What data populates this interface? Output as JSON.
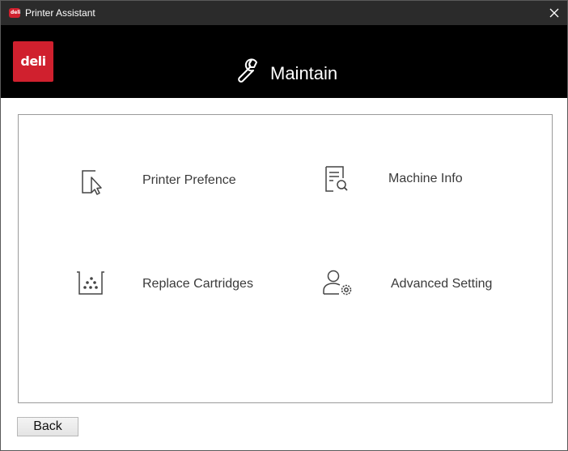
{
  "window": {
    "title": "Printer Assistant"
  },
  "brand": {
    "logo_text": "deli",
    "color": "#d0202e"
  },
  "header": {
    "title": "Maintain",
    "icon": "wrench-icon"
  },
  "tiles": [
    {
      "label": "Printer Prefence",
      "icon": "cursor-select-icon"
    },
    {
      "label": "Machine Info",
      "icon": "document-search-icon"
    },
    {
      "label": "Replace Cartridges",
      "icon": "cartridge-icon"
    },
    {
      "label": "Advanced Setting",
      "icon": "user-gear-icon"
    }
  ],
  "footer": {
    "back_label": "Back"
  }
}
